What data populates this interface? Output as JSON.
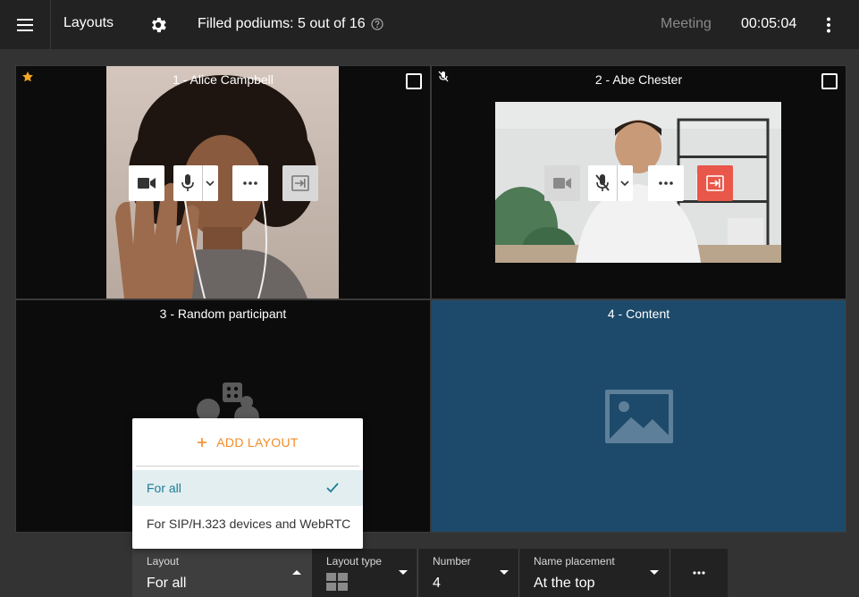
{
  "topbar": {
    "title": "Layouts",
    "podiums_text": "Filled podiums: 5 out of 16",
    "meeting_label": "Meeting",
    "timer": "00:05:04"
  },
  "tiles": [
    {
      "name": "1 - Alice Campbell",
      "corner_icon": "star-icon",
      "accent": "#f5a623"
    },
    {
      "name": "2 - Abe Chester",
      "corner_icon": "mic-off-icon"
    },
    {
      "name": "3 - Random participant"
    },
    {
      "name": "4 - Content"
    }
  ],
  "menu": {
    "add_layout_label": "ADD LAYOUT",
    "items": [
      {
        "label": "For all",
        "selected": true
      },
      {
        "label": "For SIP/H.323 devices and WebRTC",
        "selected": false
      }
    ]
  },
  "bottom": {
    "layout": {
      "label": "Layout",
      "value": "For all"
    },
    "layout_type": {
      "label": "Layout type",
      "icon": "grid-2x2-icon"
    },
    "number": {
      "label": "Number",
      "value": "4"
    },
    "name_placement": {
      "label": "Name placement",
      "value": "At the top"
    }
  },
  "colors": {
    "topbar_bg": "#222222",
    "tile_bg": "#0c0c0c",
    "content_bg": "#1d4a6a",
    "accent_orange": "#f28c28",
    "kick_red": "#e8574a",
    "selected_teal": "#1f7d93"
  }
}
